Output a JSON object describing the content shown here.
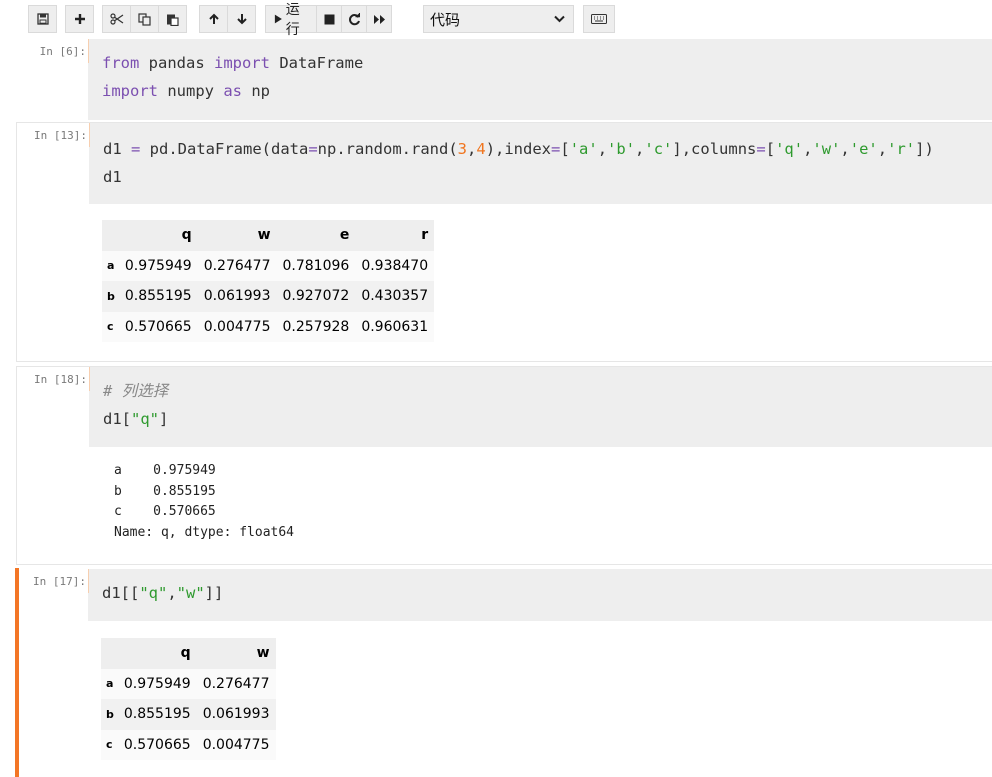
{
  "toolbar": {
    "run_label": "运行",
    "cell_type": "代码"
  },
  "cells": [
    {
      "prompt": "In [6]:",
      "code_lines": [
        [
          {
            "t": "from",
            "c": "kw"
          },
          {
            "t": " pandas "
          },
          {
            "t": "import",
            "c": "kw"
          },
          {
            "t": " DataFrame"
          }
        ],
        [
          {
            "t": "import",
            "c": "kw"
          },
          {
            "t": " numpy "
          },
          {
            "t": "as",
            "c": "kw"
          },
          {
            "t": " np"
          }
        ]
      ]
    },
    {
      "prompt": "In [13]:",
      "code_lines": [
        [
          {
            "t": "d1 "
          },
          {
            "t": "=",
            "c": "op"
          },
          {
            "t": " pd.DataFrame(data"
          },
          {
            "t": "=",
            "c": "op"
          },
          {
            "t": "np.random.rand("
          },
          {
            "t": "3",
            "c": "num"
          },
          {
            "t": ","
          },
          {
            "t": "4",
            "c": "num"
          },
          {
            "t": "),index"
          },
          {
            "t": "=",
            "c": "op"
          },
          {
            "t": "["
          },
          {
            "t": "'a'",
            "c": "str"
          },
          {
            "t": ","
          },
          {
            "t": "'b'",
            "c": "str"
          },
          {
            "t": ","
          },
          {
            "t": "'c'",
            "c": "str"
          },
          {
            "t": "],columns"
          },
          {
            "t": "=",
            "c": "op"
          },
          {
            "t": "["
          },
          {
            "t": "'q'",
            "c": "str"
          },
          {
            "t": ","
          },
          {
            "t": "'w'",
            "c": "str"
          },
          {
            "t": ","
          },
          {
            "t": "'e'",
            "c": "str"
          },
          {
            "t": ","
          },
          {
            "t": "'r'",
            "c": "str"
          },
          {
            "t": "])"
          }
        ],
        [
          {
            "t": "d1"
          }
        ]
      ],
      "output_table": {
        "columns": [
          "q",
          "w",
          "e",
          "r"
        ],
        "rows": [
          {
            "index": "a",
            "values": [
              "0.975949",
              "0.276477",
              "0.781096",
              "0.938470"
            ]
          },
          {
            "index": "b",
            "values": [
              "0.855195",
              "0.061993",
              "0.927072",
              "0.430357"
            ]
          },
          {
            "index": "c",
            "values": [
              "0.570665",
              "0.004775",
              "0.257928",
              "0.960631"
            ]
          }
        ]
      }
    },
    {
      "prompt": "In [18]:",
      "code_lines": [
        [
          {
            "t": "# 列选择",
            "c": "cmt"
          }
        ],
        [
          {
            "t": "d1["
          },
          {
            "t": "\"q\"",
            "c": "str"
          },
          {
            "t": "]"
          }
        ]
      ],
      "output_text": [
        "a    0.975949",
        "b    0.855195",
        "c    0.570665",
        "Name: q, dtype: float64"
      ]
    },
    {
      "prompt": "In [17]:",
      "code_lines": [
        [
          {
            "t": "d1[["
          },
          {
            "t": "\"q\"",
            "c": "str"
          },
          {
            "t": ","
          },
          {
            "t": "\"w\"",
            "c": "str"
          },
          {
            "t": "]]"
          }
        ]
      ],
      "output_table": {
        "columns": [
          "q",
          "w"
        ],
        "rows": [
          {
            "index": "a",
            "values": [
              "0.975949",
              "0.276477"
            ]
          },
          {
            "index": "b",
            "values": [
              "0.855195",
              "0.061993"
            ]
          },
          {
            "index": "c",
            "values": [
              "0.570665",
              "0.004775"
            ]
          }
        ]
      }
    }
  ]
}
